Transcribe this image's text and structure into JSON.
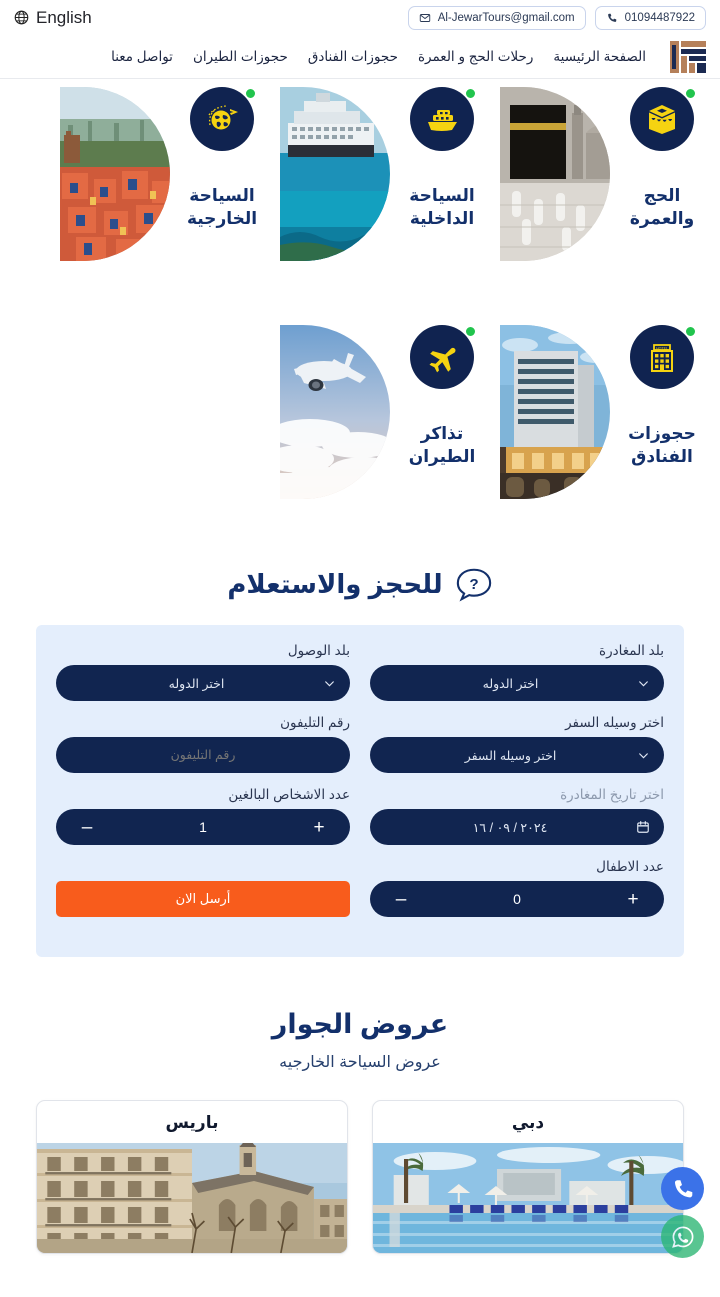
{
  "topbar": {
    "language_label": "English",
    "language_icon": "globe-icon",
    "email": "Al-JewarTours@gmail.com",
    "email_icon": "mail-icon",
    "phone": "01094487922",
    "phone_icon": "phone-icon"
  },
  "nav": {
    "logo_alt": "Al-Jewar logo",
    "items": [
      {
        "label": "الصفحة الرئيسية"
      },
      {
        "label": "رحلات الحج و العمرة"
      },
      {
        "label": "حجوزات الفنادق"
      },
      {
        "label": "حجوزات الطيران"
      },
      {
        "label": "تواصل معنا"
      }
    ]
  },
  "services": {
    "row1": [
      {
        "label": "الحج\nوالعمرة",
        "icon": "kaaba-icon",
        "photo": "kaaba-pilgrims-photo",
        "status_dot": "#21c44d"
      },
      {
        "label": "السياحة\nالداخلية",
        "icon": "cruise-ship-icon",
        "photo": "cruise-ship-photo",
        "status_dot": "#21c44d"
      },
      {
        "label": "السياحة\nالخارجية",
        "icon": "globe-plane-icon",
        "photo": "city-landscape-photo",
        "status_dot": "#21c44d"
      }
    ],
    "row2": [
      {
        "label": "حجوزات\nالفنادق",
        "icon": "hotel-building-icon",
        "photo": "hotel-exterior-photo",
        "status_dot": "#21c44d"
      },
      {
        "label": "تذاكر\nالطيران",
        "icon": "airplane-icon",
        "photo": "airplane-sky-photo",
        "status_dot": "#21c44d"
      }
    ]
  },
  "booking": {
    "section_title": "للحجز والاستعلام",
    "section_icon": "question-bubble-icon",
    "departure_country": {
      "label": "بلد المغادرة",
      "value": "اختر الدوله",
      "icon": "chevron-down-icon"
    },
    "arrival_country": {
      "label": "بلد الوصول",
      "value": "اختر الدوله",
      "icon": "chevron-down-icon"
    },
    "travel_means": {
      "label": "اختر وسيله السفر",
      "value": "اختر وسيله السفر",
      "icon": "chevron-down-icon"
    },
    "phone": {
      "label": "رقم التليفون",
      "placeholder": "رقم التليفون",
      "value": ""
    },
    "departure_date": {
      "label": "اختر تاريخ المغادرة",
      "value": "٢٠٢٤ / ٠٩ / ١٦",
      "icon": "calendar-icon"
    },
    "adults": {
      "label": "عدد الاشخاص البالغين",
      "value": "1",
      "plus": "+",
      "minus": "–"
    },
    "children": {
      "label": "عدد الاطفال",
      "value": "0",
      "plus": "+",
      "minus": "–"
    },
    "submit_label": "أرسل الان",
    "submit_color": "#f85c1c"
  },
  "offers": {
    "title": "عروض الجوار",
    "subtitle": "عروض السياحة الخارجيه",
    "cards": [
      {
        "name": "دبي",
        "photo": "dubai-pool-photo"
      },
      {
        "name": "باريس",
        "photo": "paris-buildings-photo"
      }
    ]
  },
  "floating": {
    "call_icon": "phone-icon",
    "call_color": "#3b72e8",
    "whatsapp_icon": "whatsapp-icon",
    "whatsapp_color": "#2bb673"
  },
  "theme": {
    "navy": "#112550",
    "deep_blue": "#13306b",
    "yellow": "#f5d311",
    "form_bg": "#e4eefc",
    "orange": "#f85c1c"
  }
}
